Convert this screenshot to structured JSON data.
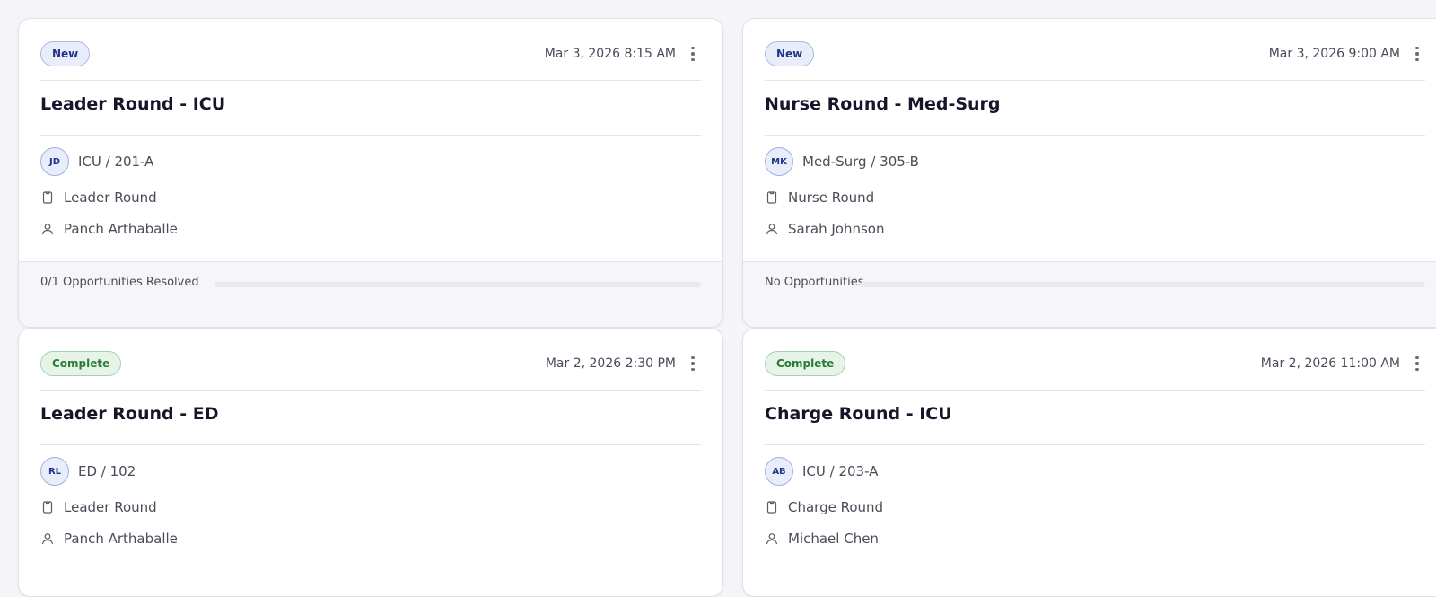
{
  "cards": [
    {
      "status": "New",
      "timestamp": "Mar 3, 2026 8:15 AM",
      "title": "Leader Round - ICU",
      "avatar_initials": "JD",
      "location": "ICU / 201-A",
      "round_type": "Leader Round",
      "person": "Panch Arthaballe",
      "opportunities_label": "0/1 Opportunities Resolved",
      "progress": 0
    },
    {
      "status": "New",
      "timestamp": "Mar 3, 2026 9:00 AM",
      "title": "Nurse Round - Med-Surg",
      "avatar_initials": "MK",
      "location": "Med-Surg / 305-B",
      "round_type": "Nurse Round",
      "person": "Sarah Johnson",
      "opportunities_label": "No Opportunities",
      "progress": 0
    },
    {
      "status": "Complete",
      "timestamp": "Mar 2, 2026 2:30 PM",
      "title": "Leader Round - ED",
      "avatar_initials": "RL",
      "location": "ED / 102",
      "round_type": "Leader Round",
      "person": "Panch Arthaballe"
    },
    {
      "status": "Complete",
      "timestamp": "Mar 2, 2026 11:00 AM",
      "title": "Charge Round - ICU",
      "avatar_initials": "AB",
      "location": "ICU / 203-A",
      "round_type": "Charge Round",
      "person": "Michael Chen"
    }
  ],
  "colors": {
    "new_badge_bg": "#e8edfa",
    "complete_badge_bg": "#e6f4e8",
    "page_bg": "#f4f4f9"
  },
  "icons": {
    "menu": "more-vertical-icon",
    "round_type": "clipboard-icon",
    "person": "user-icon"
  }
}
